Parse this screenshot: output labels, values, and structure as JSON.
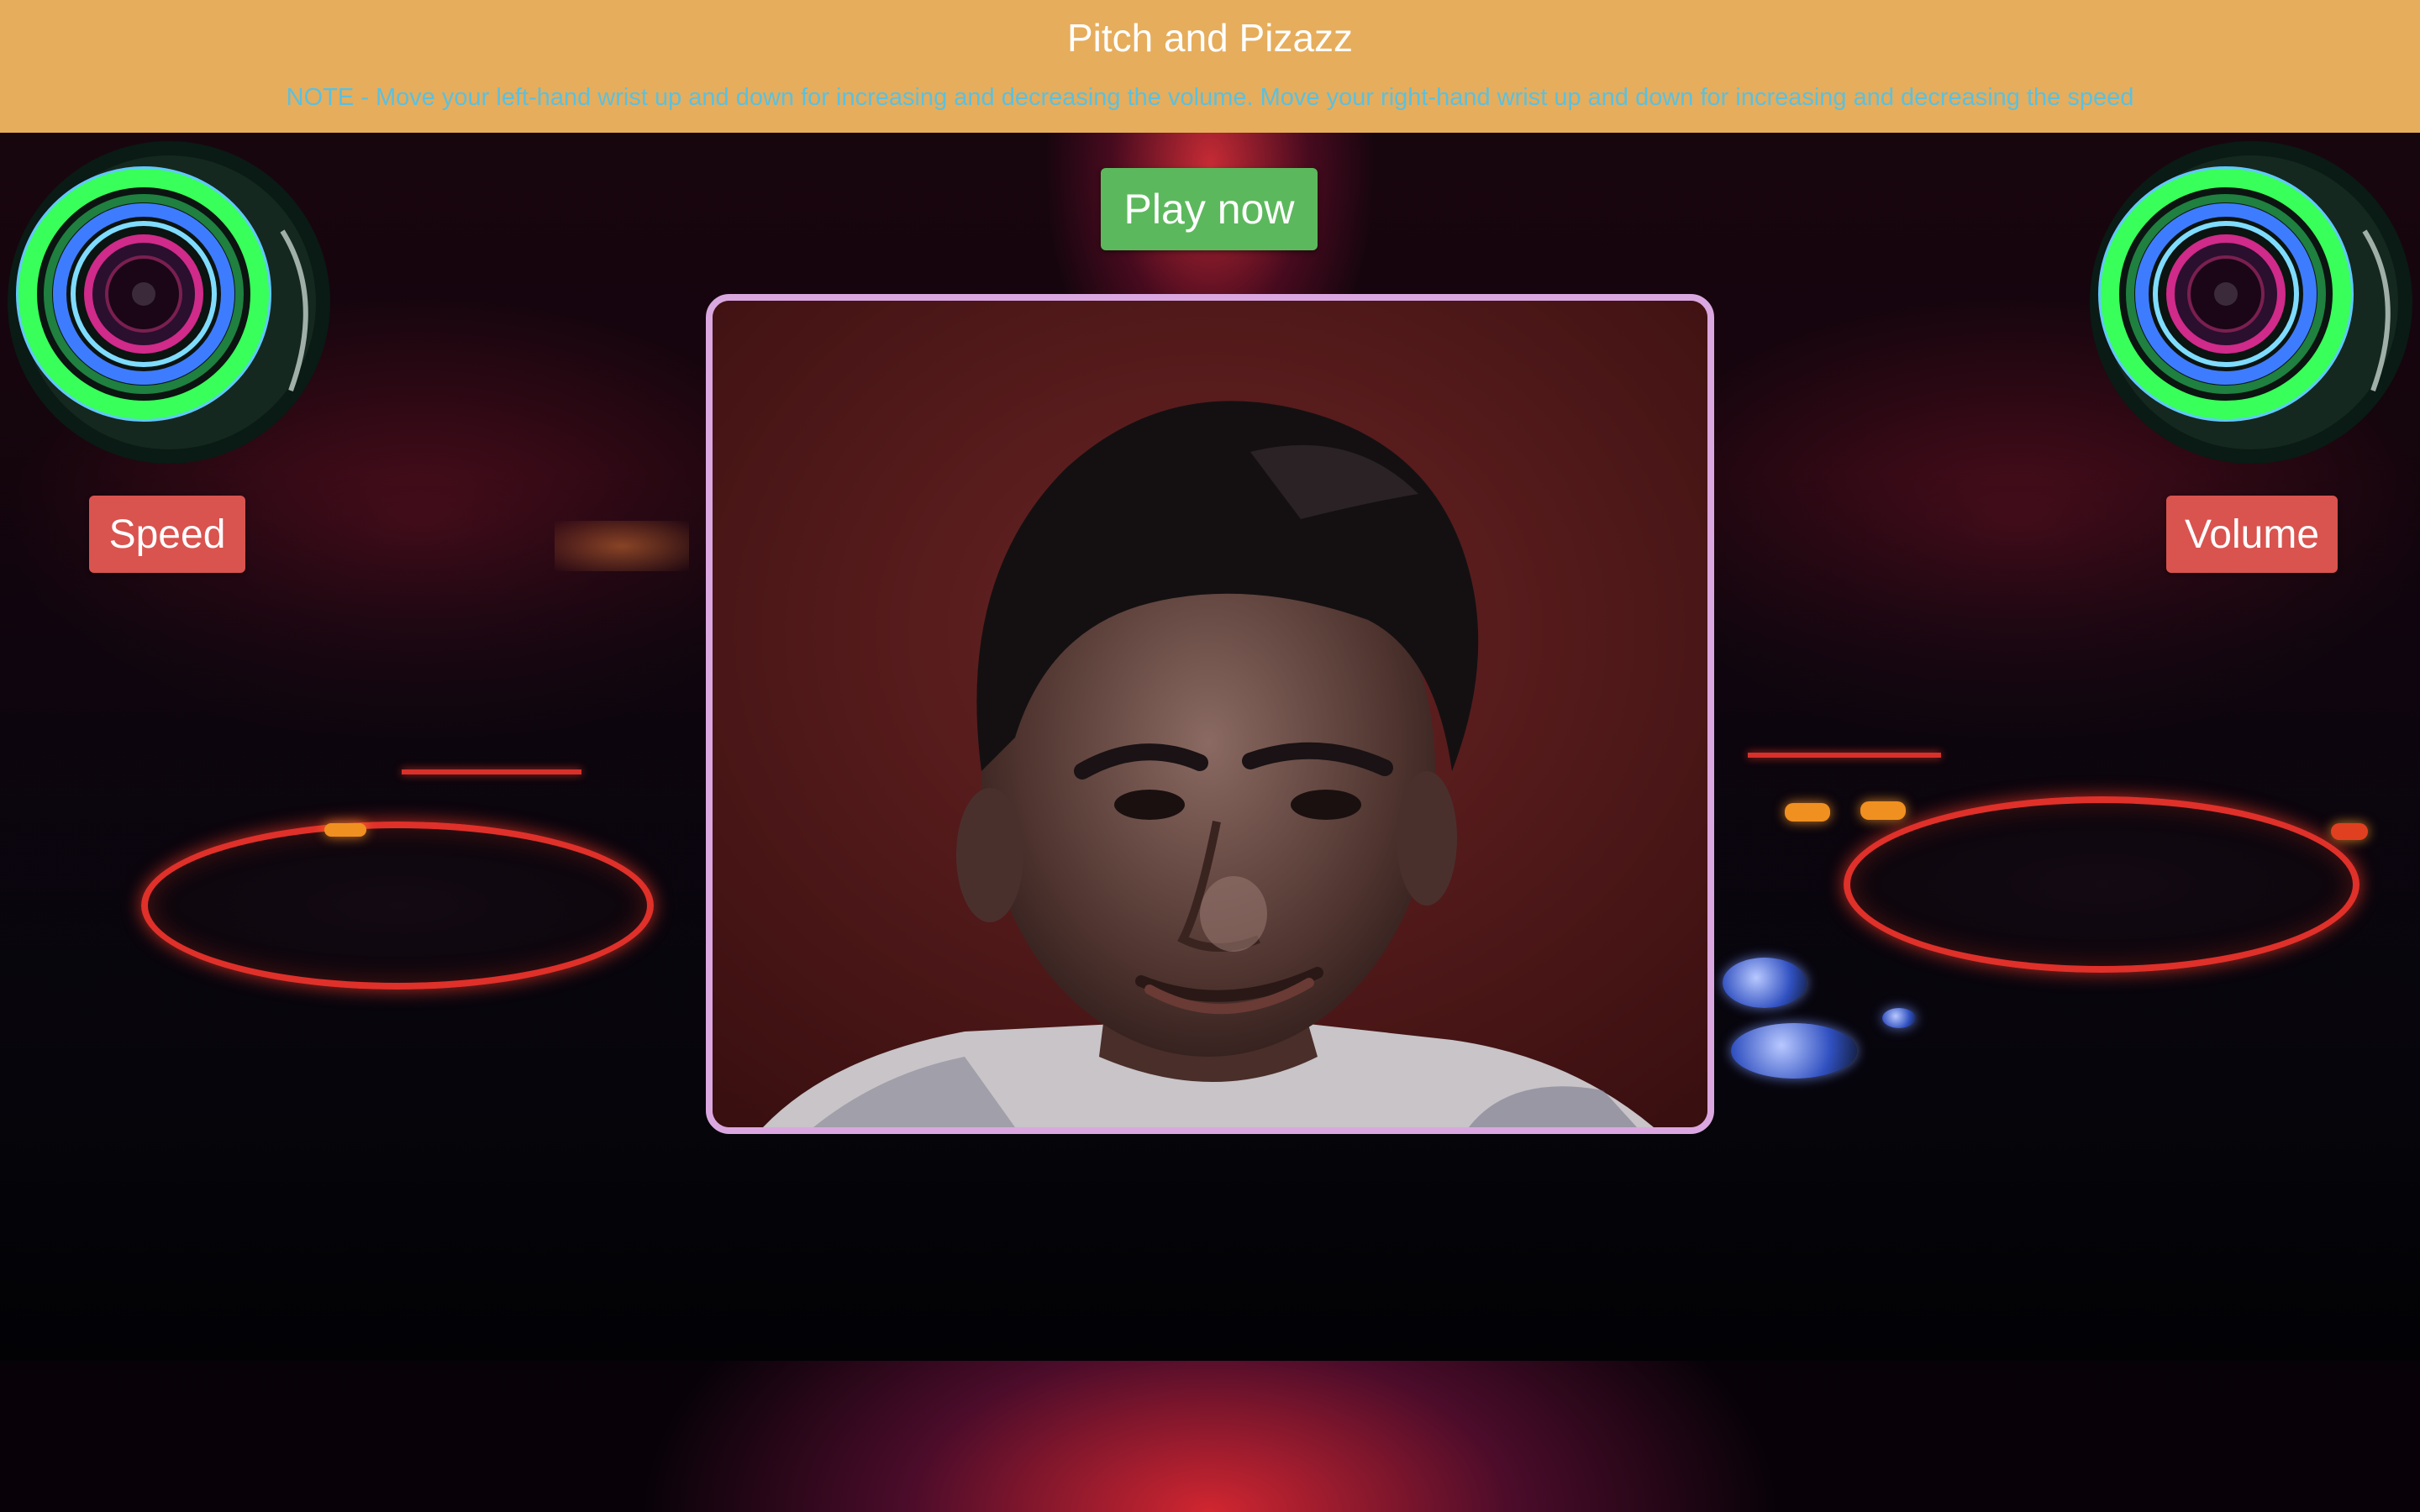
{
  "header": {
    "title": "Pitch and Pizazz",
    "note": "NOTE - Move your left-hand wrist up and down for increasing and decreasing the volume. Move your right-hand wrist up and down for increasing and decreasing the speed"
  },
  "controls": {
    "play_label": "Play now",
    "speed_label": "Speed",
    "volume_label": "Volume"
  },
  "colors": {
    "header_bg": "#e6ad5c",
    "note_text": "#5bc0de",
    "play_button": "#5cb85c",
    "control_button": "#d9534f",
    "video_border": "#dba7e0"
  },
  "icons": {
    "left_speaker": "neon-speaker-icon",
    "right_speaker": "neon-speaker-icon"
  }
}
